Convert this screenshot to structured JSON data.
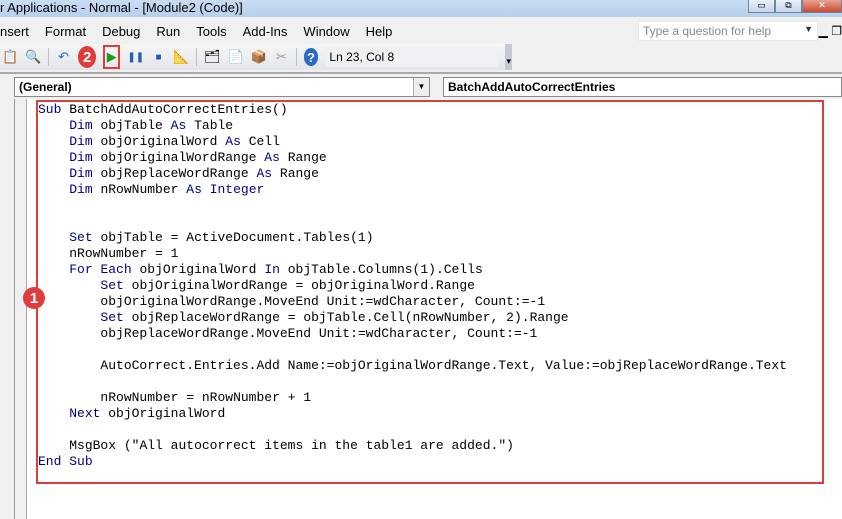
{
  "window": {
    "title": "r Applications - Normal - [Module2 (Code)]",
    "min": "▭",
    "max": "⧉",
    "close": "✕"
  },
  "menu": [
    "nsert",
    "Format",
    "Debug",
    "Run",
    "Tools",
    "Add-Ins",
    "Window",
    "Help"
  ],
  "help": {
    "placeholder": "Type a question for help"
  },
  "toolbar": {
    "position": "Ln 23, Col 8",
    "badge": "2"
  },
  "combos": {
    "object": "(General)",
    "procedure": "BatchAddAutoCorrectEntries"
  },
  "editor": {
    "badge": "1",
    "keywords": [
      "Sub",
      "Dim",
      "As",
      "Integer",
      "Set",
      "For",
      "Each",
      "In",
      "Next",
      "End"
    ],
    "lines": [
      "Sub BatchAddAutoCorrectEntries()",
      "    Dim objTable As Table",
      "    Dim objOriginalWord As Cell",
      "    Dim objOriginalWordRange As Range",
      "    Dim objReplaceWordRange As Range",
      "    Dim nRowNumber As Integer",
      "",
      "",
      "    Set objTable = ActiveDocument.Tables(1)",
      "    nRowNumber = 1",
      "    For Each objOriginalWord In objTable.Columns(1).Cells",
      "        Set objOriginalWordRange = objOriginalWord.Range",
      "        objOriginalWordRange.MoveEnd Unit:=wdCharacter, Count:=-1",
      "        Set objReplaceWordRange = objTable.Cell(nRowNumber, 2).Range",
      "        objReplaceWordRange.MoveEnd Unit:=wdCharacter, Count:=-1",
      "",
      "        AutoCorrect.Entries.Add Name:=objOriginalWordRange.Text, Value:=objReplaceWordRange.Text",
      "",
      "        nRowNumber = nRowNumber + 1",
      "    Next objOriginalWord",
      "",
      "    MsgBox (\"All autocorrect items in the table1 are added.\")",
      "End Sub"
    ]
  },
  "colors": {
    "highlight": "#e03c3c",
    "keyword": "#00008b"
  }
}
